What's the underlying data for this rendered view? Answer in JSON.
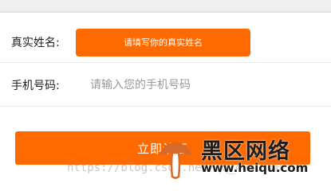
{
  "form": {
    "name_label": "真实姓名:",
    "name_placeholder": "请填写你的真实姓名",
    "phone_label": "手机号码:",
    "phone_placeholder": "请输入您的手机号码",
    "submit_label": "立即认证"
  },
  "watermark": {
    "url_text": "https://blog.csdn.net/qq_40...10",
    "logo_cn": "黑区网络",
    "logo_en": "www.heiqu.com",
    "logo_icon": "mushroom-logo-icon"
  },
  "colors": {
    "accent": "#ff6a00",
    "label_text": "#222222",
    "placeholder_text": "#999999",
    "top_bar": "#efefef"
  }
}
